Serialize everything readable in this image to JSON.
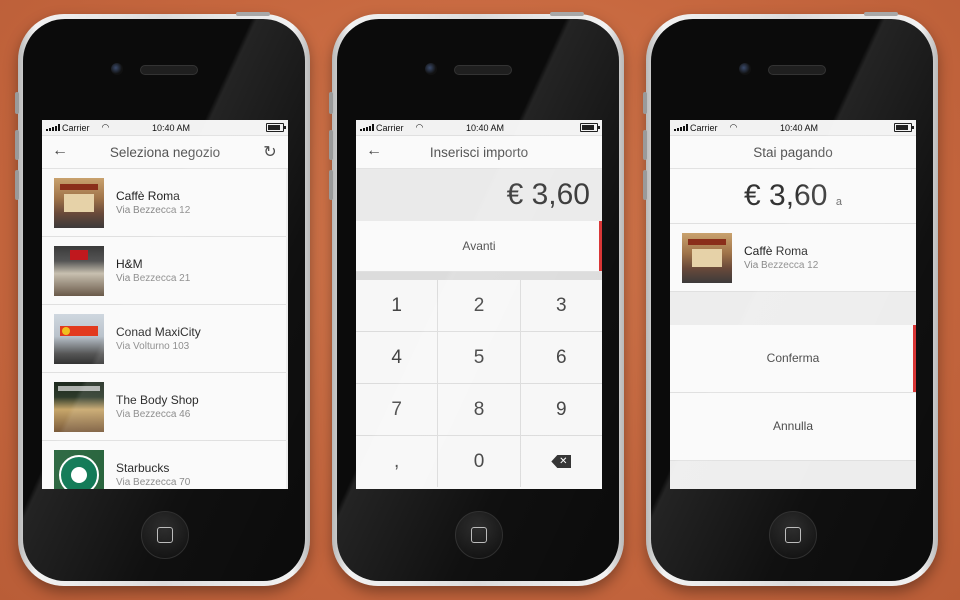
{
  "status_bar": {
    "carrier": "Carrier",
    "time": "10:40 AM"
  },
  "screens": {
    "store_select": {
      "title": "Seleziona negozio",
      "stores": [
        {
          "name": "Caffè Roma",
          "address": "Via Bezzecca 12"
        },
        {
          "name": "H&M",
          "address": "Via Bezzecca 21"
        },
        {
          "name": "Conad MaxiCity",
          "address": "Via Volturno 103"
        },
        {
          "name": "The Body Shop",
          "address": "Via Bezzecca 46"
        },
        {
          "name": "Starbucks",
          "address": "Via Bezzecca 70"
        }
      ]
    },
    "amount_entry": {
      "title": "Inserisci importo",
      "amount": "€ 3,60",
      "next_label": "Avanti",
      "keys": [
        "1",
        "2",
        "3",
        "4",
        "5",
        "6",
        "7",
        "8",
        "9",
        ",",
        "0"
      ]
    },
    "paying": {
      "title": "Stai pagando",
      "amount": "€ 3,60",
      "amount_suffix": "a",
      "store": {
        "name": "Caffè Roma",
        "address": "Via Bezzecca 12"
      },
      "confirm_label": "Conferma",
      "cancel_label": "Annulla"
    }
  },
  "colors": {
    "background": "#c96b42",
    "accent": "#d83232"
  },
  "icons": [
    "back-arrow-icon",
    "refresh-icon",
    "backspace-icon",
    "wifi-icon",
    "signal-icon",
    "battery-icon"
  ]
}
